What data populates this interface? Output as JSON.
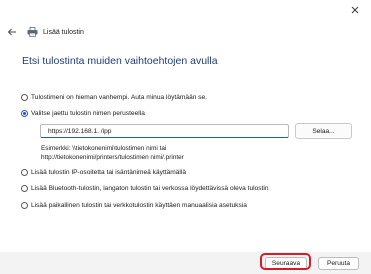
{
  "window": {
    "close_icon": "close-icon",
    "back_icon": "arrow-left-icon",
    "printer_icon": "printer-icon",
    "header_title": "Lisää tulostin"
  },
  "main": {
    "title": "Etsi tulostinta muiden vaihtoehtojen avulla",
    "options": [
      {
        "label": "Tulostimeni on hieman vanhempi. Auta minua löytämään se.",
        "checked": false
      },
      {
        "label": "Valitse jaettu tulostin nimen perusteella",
        "checked": true
      },
      {
        "label": "Lisää tulostin IP-osoitetta tai isäntänimeä käyttämällä",
        "checked": false
      },
      {
        "label": "Lisää Bluetooth-tulostin, langaton tulostin tai verkossa löydettävissä oleva tulostin",
        "checked": false
      },
      {
        "label": "Lisää paikallinen tulostin tai verkkotulostin käyttäen manuaalisia asetuksia",
        "checked": false
      }
    ],
    "url_value": "https://192.168.1.   /ipp",
    "browse_label": "Selaa...",
    "example_line1": "Esimerkki: \\\\tietokonenimi\\tulostimen nimi tai",
    "example_line2": "http://tietokonenimi/printers/tulostimen nimi/.printer"
  },
  "footer": {
    "next_label": "Seuraava",
    "cancel_label": "Peruuta",
    "highlight_color": "#d01f2b"
  },
  "colors": {
    "accent": "#1c5bb8",
    "title": "#1f3d7a"
  }
}
